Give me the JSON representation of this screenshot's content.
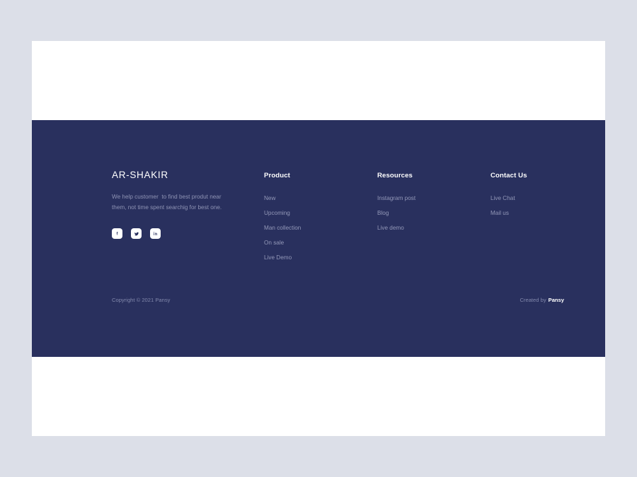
{
  "colors": {
    "page_background": "#dcdfe8",
    "card_background": "#ffffff",
    "footer_navy": "#29305e",
    "muted_text": "#9398b8",
    "heading_white": "#ffffff"
  },
  "footer": {
    "brand": {
      "title": "AR-SHAKIR",
      "description": "We help customer  to find best produt near them, not time spent searchig for best one.",
      "social": [
        {
          "name": "facebook-icon",
          "label": "Facebook"
        },
        {
          "name": "twitter-icon",
          "label": "Twitter"
        },
        {
          "name": "linkedin-icon",
          "label": "LinkedIn"
        }
      ]
    },
    "columns": [
      {
        "heading": "Product",
        "links": [
          "New",
          "Upcoming",
          "Man collection",
          "On sale",
          "Live Demo"
        ]
      },
      {
        "heading": "Resources",
        "links": [
          "Instagram post",
          "Blog",
          "Live demo"
        ]
      },
      {
        "heading": "Contact Us",
        "links": [
          "Live Chat",
          "Mail us"
        ]
      }
    ],
    "bottom": {
      "copyright": "Copyright © 2021 Pansy",
      "credit_prefix": "Created by",
      "credit_brand": "Pansy"
    }
  }
}
